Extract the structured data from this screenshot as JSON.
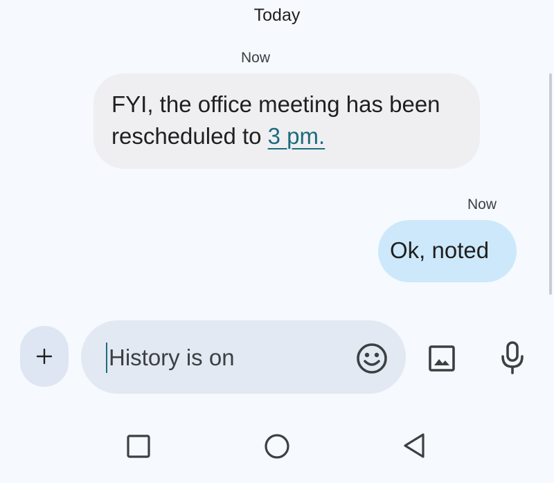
{
  "conversation": {
    "date_divider": "Today",
    "messages": [
      {
        "direction": "incoming",
        "timestamp": "Now",
        "text_before_link": "FYI, the office meeting has been rescheduled to ",
        "link_text": "3 pm."
      },
      {
        "direction": "outgoing",
        "timestamp": "Now",
        "text": "Ok, noted"
      }
    ]
  },
  "composer": {
    "add_label": "+",
    "input_value": "",
    "placeholder": "History is on",
    "icons": [
      "emoji-icon",
      "image-icon",
      "microphone-icon"
    ]
  },
  "nav_bar": {
    "icons": [
      "recents-icon",
      "home-icon",
      "back-icon"
    ]
  },
  "colors": {
    "background": "#f6f9fd",
    "incoming_bubble": "#efeff1",
    "outgoing_bubble": "#cde8fb",
    "link": "#1c6b7d",
    "compose_field": "#e3e9f2",
    "add_button": "#dde6f2",
    "icon": "#3c4043"
  }
}
